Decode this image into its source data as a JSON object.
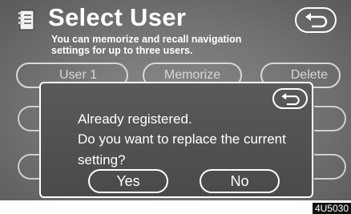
{
  "header": {
    "title": "Select User",
    "subtitle_line1": "You can memorize and recall navigation",
    "subtitle_line2": "settings for up to three users.",
    "icon": "user-list-icon"
  },
  "background_buttons": {
    "user1_label": "User 1",
    "memorize_label": "Memorize",
    "delete_label": "Delete"
  },
  "dialog": {
    "message_line1": "Already registered.",
    "message_line2": "Do you want to replace the current",
    "message_line3": "setting?",
    "yes_label": "Yes",
    "no_label": "No"
  },
  "figure_code": "4U5030",
  "icons": {
    "back": "back-arrow-icon"
  },
  "colors": {
    "screen_bg": "#707070",
    "foreground": "#ffffff"
  }
}
